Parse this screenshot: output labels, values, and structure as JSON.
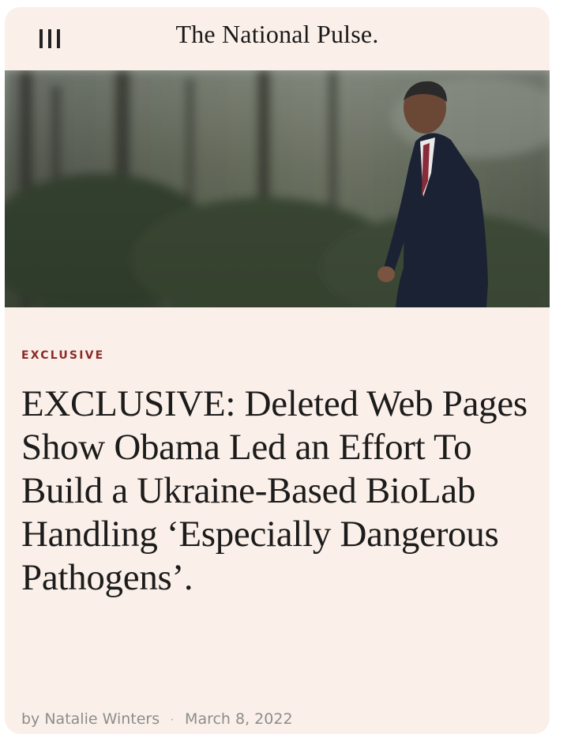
{
  "header": {
    "site_title": "The National Pulse.",
    "menu_icon": "hamburger-menu-icon"
  },
  "hero": {
    "alt": "Man in a dark suit walking outdoors in front of trees"
  },
  "article": {
    "kicker": "EXCLUSIVE",
    "headline": "EXCLUSIVE: Deleted Web Pages Show Obama Led an Effort To Build a Ukraine-Based BioLab Handling ‘Especially Dangerous Pathogens’.",
    "author": "by Natalie Winters",
    "separator": "·",
    "date": "March 8, 2022"
  },
  "colors": {
    "background": "#fbf0e9",
    "kicker": "#8b2a28",
    "text": "#1c1c1c",
    "meta": "#8c8c8c"
  }
}
